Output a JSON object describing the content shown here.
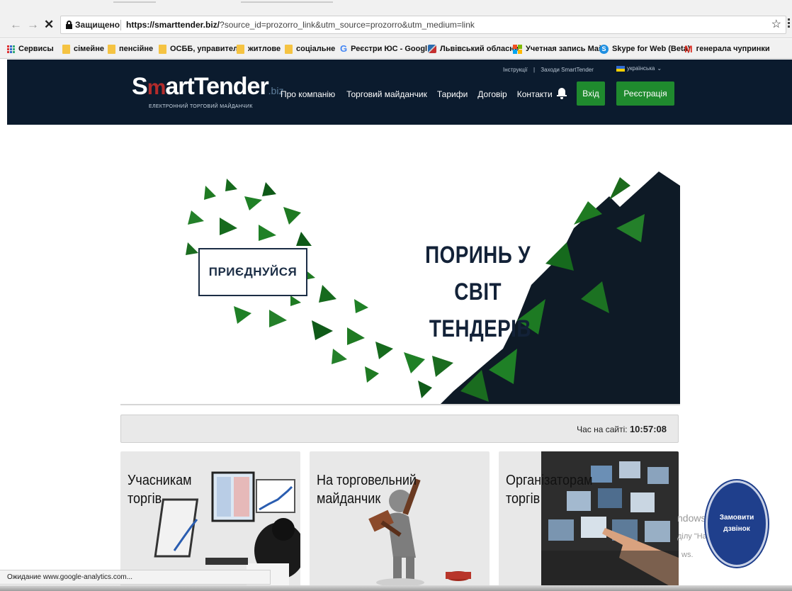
{
  "browser": {
    "back_glyph": "←",
    "forward_glyph": "→",
    "stop_glyph": "✕",
    "secure_label": "Защищено",
    "url_host": "https://smarttender.biz/",
    "url_rest": "?source_id=prozorro_link&utm_source=prozorro&utm_medium=link",
    "star_glyph": "☆"
  },
  "bookmarks": [
    {
      "label": "Сервисы",
      "icon": "apps-icon"
    },
    {
      "label": "сімейне",
      "icon": "folder-icon"
    },
    {
      "label": "пенсійне",
      "icon": "folder-icon"
    },
    {
      "label": "ОСББ, управитель",
      "icon": "folder-icon"
    },
    {
      "label": "житлове",
      "icon": "folder-icon"
    },
    {
      "label": "соціальне",
      "icon": "folder-icon"
    },
    {
      "label": "Реєстри ЮС - Googl",
      "icon": "google-icon"
    },
    {
      "label": "Львівський обласни",
      "icon": "lviv-icon"
    },
    {
      "label": "Учетная запись Май",
      "icon": "microsoft-icon"
    },
    {
      "label": "Skype for Web (Beta)",
      "icon": "skype-icon"
    },
    {
      "label": "генерала чупринки",
      "icon": "gmail-icon"
    }
  ],
  "header": {
    "logo_s": "S",
    "logo_m": "m",
    "logo_rest": "artTender",
    "logo_biz": ".biz",
    "logo_sub": "ЕЛЕКТРОННИЙ ТОРГОВИЙ МАЙДАНЧИК",
    "top_link_1": "Інструкції",
    "top_sep": "|",
    "top_link_2": "Заходи SmartTender",
    "lang": "українська",
    "lang_caret": "⌄",
    "nav": [
      "Про компанію",
      "Торговий майданчик",
      "Тарифи",
      "Договір",
      "Контакти"
    ],
    "login": "Вхід",
    "register": "Реєстрація"
  },
  "hero": {
    "join": "ПРИЄДНУЙСЯ",
    "title_line1": "ПОРИНЬ У СВІТ",
    "title_line2": "ТЕНДЕРІВ",
    "accent_color": "#1f6b1f",
    "dark_color": "#132238"
  },
  "timebar": {
    "label": "Час на сайті:",
    "time": "10:57:08"
  },
  "cards": [
    {
      "line1": "Учасникам",
      "line2": "торгів"
    },
    {
      "line1": "На торговельний",
      "line2": "майданчик"
    },
    {
      "line1": "Організаторам",
      "line2": "торгів"
    }
  ],
  "windows_overlay": {
    "line1": "ndows",
    "line2": "ділу \"Нас",
    "line3": "ws.",
    "trailing": "об"
  },
  "call_button": {
    "line1": "Замовити",
    "line2": "дзвінок"
  },
  "status": "Ожидание www.google-analytics.com..."
}
